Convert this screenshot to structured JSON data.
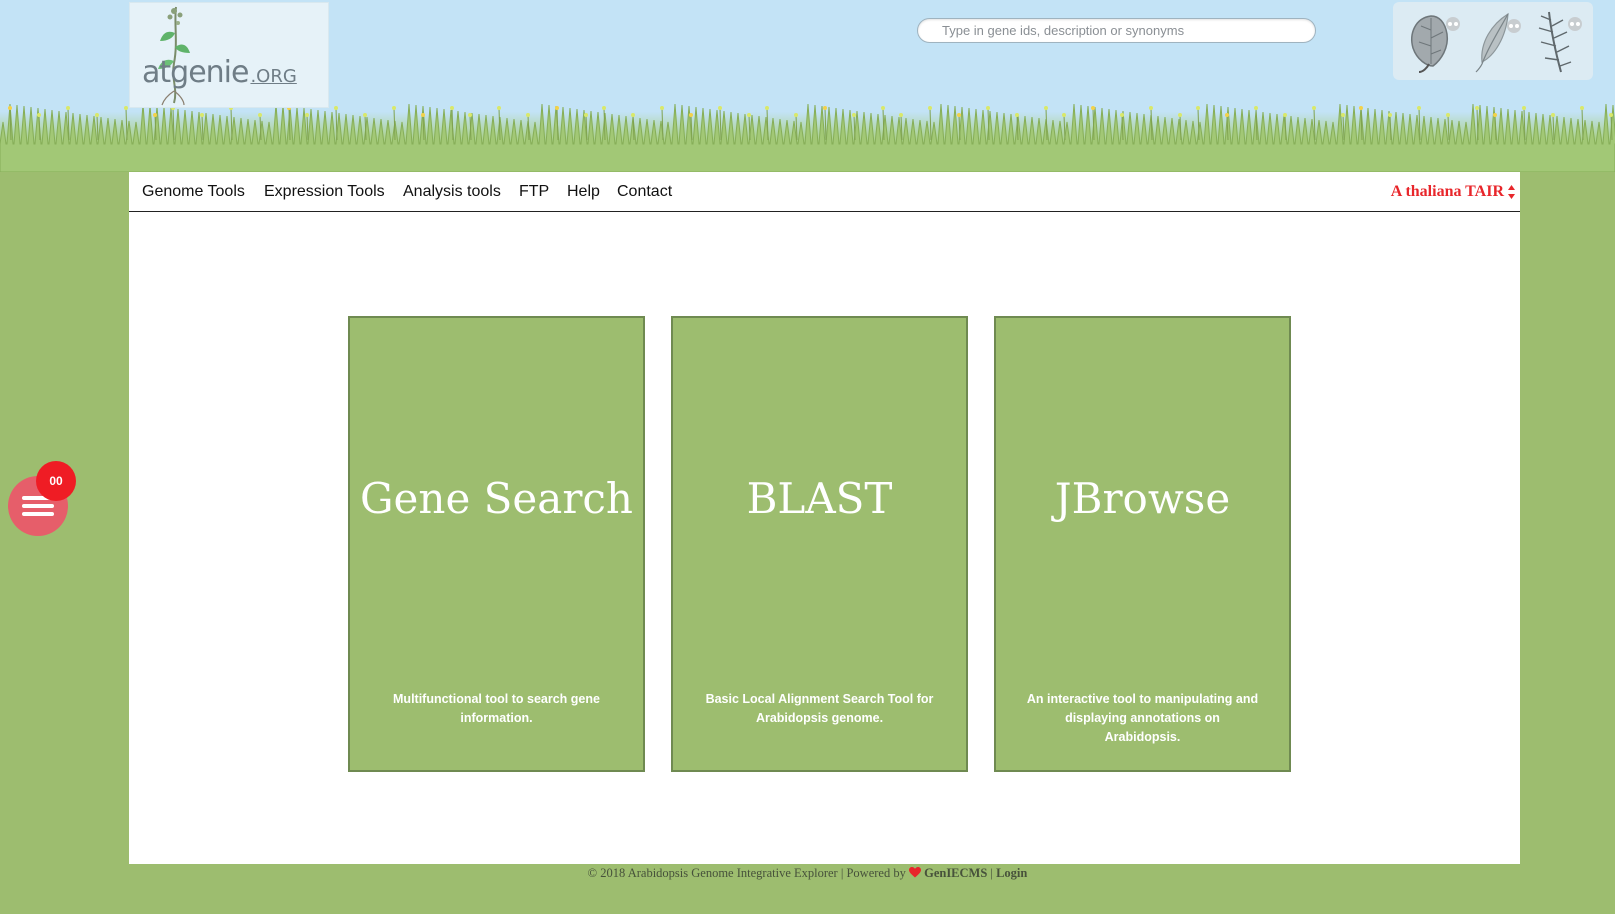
{
  "header": {
    "logo": {
      "name": "atgenie",
      "suffix": ".ORG"
    },
    "search": {
      "placeholder": "Type in gene ids, description or synonyms",
      "value": ""
    },
    "species_icons": [
      "aspen-leaf-icon",
      "willow-leaf-icon",
      "spruce-branch-icon"
    ]
  },
  "nav": {
    "items": [
      {
        "label": "Genome Tools"
      },
      {
        "label": "Expression Tools"
      },
      {
        "label": "Analysis tools"
      },
      {
        "label": "FTP"
      },
      {
        "label": "Help"
      },
      {
        "label": "Contact"
      }
    ],
    "species_select": "A thaliana TAIR"
  },
  "cards": [
    {
      "title": "Gene Search",
      "description": "Multifunctional tool to search gene information."
    },
    {
      "title": "BLAST",
      "description": "Basic Local Alignment Search Tool for Arabidopsis genome."
    },
    {
      "title": "JBrowse",
      "description": "An interactive tool to manipulating and displaying annotations on Arabidopsis."
    }
  ],
  "footer": {
    "copyright": "© 2018 Arabidopsis Genome Integrative Explorer | Powered by",
    "brand": "GenIECMS",
    "separator": "|",
    "login": "Login"
  },
  "floating_menu": {
    "badge": "00"
  },
  "colors": {
    "sky": "#c3e3f6",
    "background_green": "#9dbd6f",
    "card_border": "#6f8a51",
    "species_select_red": "#e8262b",
    "badge_red": "#ef1c24",
    "fab_pink": "#e65e6a"
  }
}
